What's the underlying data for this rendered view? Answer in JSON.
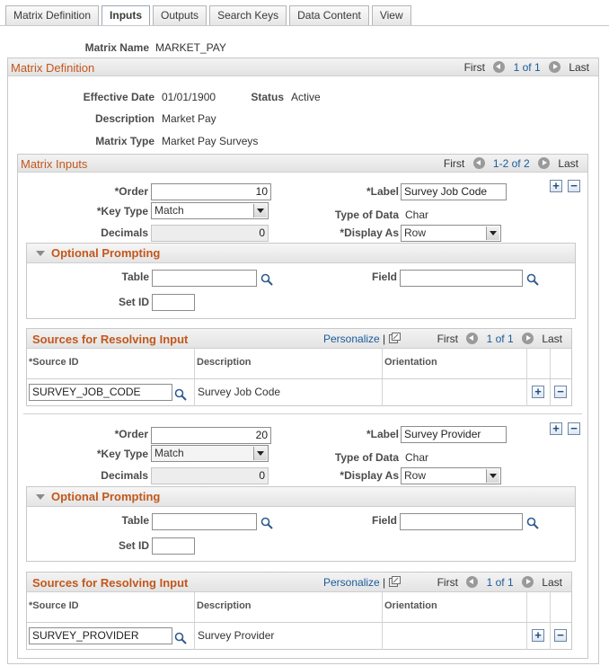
{
  "tabs": [
    {
      "label": "Matrix Definition"
    },
    {
      "label": "Inputs"
    },
    {
      "label": "Outputs"
    },
    {
      "label": "Search Keys"
    },
    {
      "label": "Data Content"
    },
    {
      "label": "View"
    }
  ],
  "matrix_name": {
    "label": "Matrix Name",
    "value": "MARKET_PAY"
  },
  "definition": {
    "title": "Matrix Definition",
    "nav": {
      "first": "First",
      "count": "1 of 1",
      "last": "Last"
    },
    "effective_date": {
      "label": "Effective Date",
      "value": "01/01/1900"
    },
    "status": {
      "label": "Status",
      "value": "Active"
    },
    "description": {
      "label": "Description",
      "value": "Market Pay"
    },
    "matrix_type": {
      "label": "Matrix Type",
      "value": "Market Pay Surveys"
    }
  },
  "inputs": {
    "title": "Matrix Inputs",
    "nav": {
      "first": "First",
      "count": "1-2 of 2",
      "last": "Last"
    },
    "rows": [
      {
        "order_label": "*Order",
        "order": "10",
        "key_type_label": "*Key Type",
        "key_type": "Match",
        "decimals_label": "Decimals",
        "decimals": "0",
        "label_label": "*Label",
        "label": "Survey Job Code",
        "type_of_data_label": "Type of Data",
        "type_of_data": "Char",
        "display_as_label": "*Display As",
        "display_as": "Row",
        "optional_title": "Optional Prompting",
        "table_label": "Table",
        "table": "",
        "field_label": "Field",
        "field": "",
        "setid_label": "Set ID",
        "setid": "",
        "sources": {
          "title": "Sources for Resolving Input",
          "personalize": "Personalize",
          "nav": {
            "first": "First",
            "count": "1 of 1",
            "last": "Last"
          },
          "col_source": "*Source ID",
          "col_desc": "Description",
          "col_orient": "Orientation",
          "source_id": "SURVEY_JOB_CODE",
          "description": "Survey Job Code",
          "orientation": ""
        }
      },
      {
        "order_label": "*Order",
        "order": "20",
        "key_type_label": "*Key Type",
        "key_type": "Match",
        "decimals_label": "Decimals",
        "decimals": "0",
        "label_label": "*Label",
        "label": "Survey Provider",
        "type_of_data_label": "Type of Data",
        "type_of_data": "Char",
        "display_as_label": "*Display As",
        "display_as": "Row",
        "optional_title": "Optional Prompting",
        "table_label": "Table",
        "table": "",
        "field_label": "Field",
        "field": "",
        "setid_label": "Set ID",
        "setid": "",
        "sources": {
          "title": "Sources for Resolving Input",
          "personalize": "Personalize",
          "nav": {
            "first": "First",
            "count": "1 of 1",
            "last": "Last"
          },
          "col_source": "*Source ID",
          "col_desc": "Description",
          "col_orient": "Orientation",
          "source_id": "SURVEY_PROVIDER",
          "description": "Survey Provider",
          "orientation": ""
        }
      }
    ]
  },
  "colors": {
    "accent": "#c3571b",
    "link": "#1a5a9a"
  }
}
